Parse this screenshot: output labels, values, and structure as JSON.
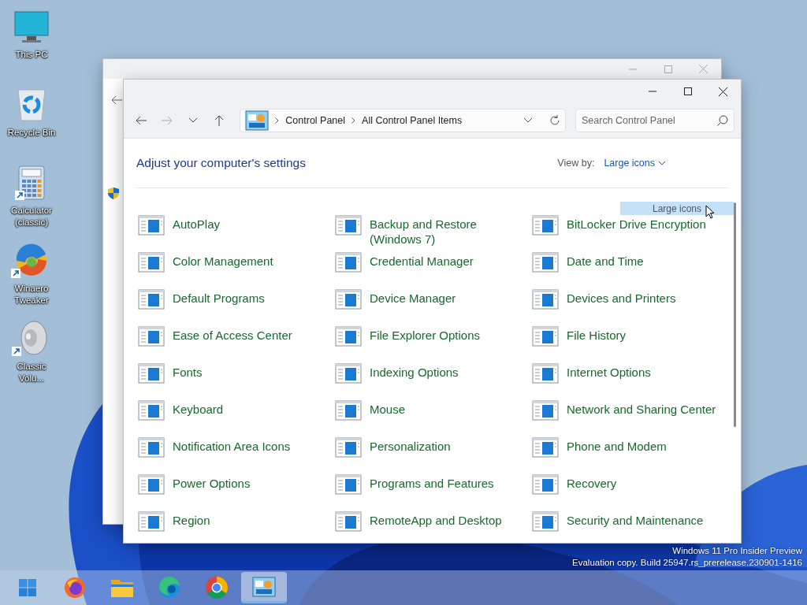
{
  "desktop_icons": [
    {
      "label": "This PC",
      "kind": "computer",
      "shortcut": false
    },
    {
      "label": "Recycle Bin",
      "kind": "recycle",
      "shortcut": false
    },
    {
      "label": "Calculator (classic)",
      "kind": "calculator",
      "shortcut": true
    },
    {
      "label": "Winaero Tweaker",
      "kind": "tweaker",
      "shortcut": true
    },
    {
      "label": "Classic Volu...",
      "kind": "speaker",
      "shortcut": true
    }
  ],
  "window": {
    "address": {
      "crumbs": [
        "Control Panel",
        "All Control Panel Items"
      ]
    },
    "search": {
      "placeholder": "Search Control Panel"
    },
    "heading": "Adjust your computer's settings",
    "view_by": {
      "label": "View by:",
      "value": "Large icons"
    },
    "drag_ghost": "Large icons",
    "items": [
      "AutoPlay",
      "Backup and Restore (Windows 7)",
      "BitLocker Drive Encryption",
      "Color Management",
      "Credential Manager",
      "Date and Time",
      "Default Programs",
      "Device Manager",
      "Devices and Printers",
      "Ease of Access Center",
      "File Explorer Options",
      "File History",
      "Fonts",
      "Indexing Options",
      "Internet Options",
      "Keyboard",
      "Mouse",
      "Network and Sharing Center",
      "Notification Area Icons",
      "Personalization",
      "Phone and Modem",
      "Power Options",
      "Programs and Features",
      "Recovery",
      "Region",
      "RemoteApp and Desktop",
      "Security and Maintenance"
    ]
  },
  "watermark": [
    "Windows 11 Pro Insider Preview",
    "Evaluation copy. Build 25947.rs_prerelease.230901-1416"
  ],
  "taskbar": [
    {
      "kind": "start",
      "selected": false
    },
    {
      "kind": "firefox",
      "selected": false
    },
    {
      "kind": "folder",
      "selected": false
    },
    {
      "kind": "edge",
      "selected": false
    },
    {
      "kind": "chrome",
      "selected": false
    },
    {
      "kind": "control-panel",
      "selected": true
    }
  ]
}
